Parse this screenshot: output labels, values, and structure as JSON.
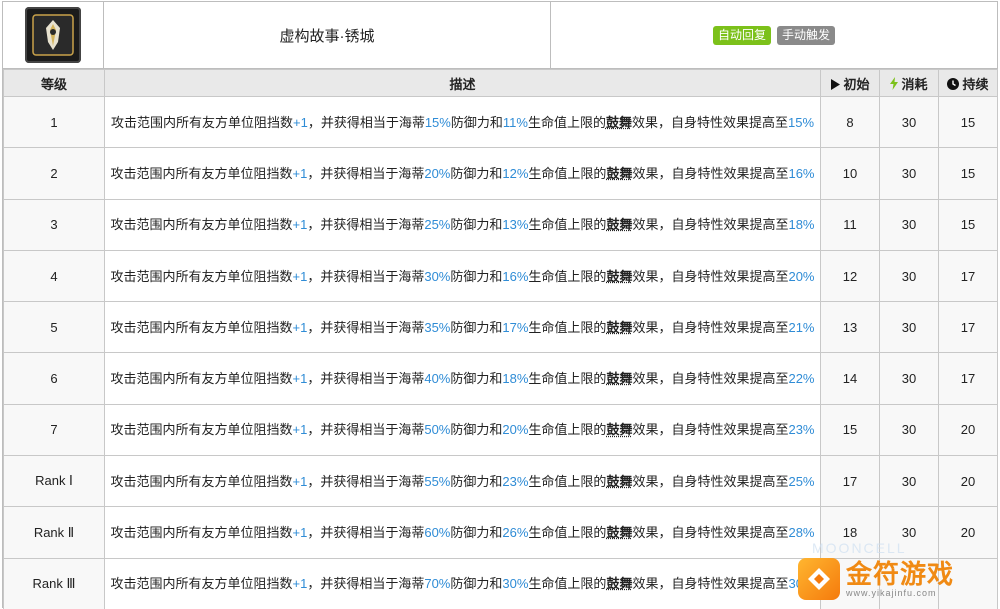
{
  "skill": {
    "name": "虚构故事·锈城",
    "tags": [
      "自动回复",
      "手动触发"
    ]
  },
  "table": {
    "headers": {
      "level": "等级",
      "desc": "描述",
      "init": "初始",
      "cost": "消耗",
      "duration": "持续"
    },
    "desc_text": {
      "a": "攻击范围内所有友方单位阻挡数",
      "plus": "+1",
      "b": "，并获得相当于海蒂",
      "c": "防御力和",
      "d": "生命值上限的",
      "e": "鼓舞",
      "f": "效果，自身特性效果提高至"
    },
    "rows": [
      {
        "level": "1",
        "def": "15%",
        "hp": "11%",
        "trait": "15%",
        "init": "8",
        "cost": "30",
        "duration": "15"
      },
      {
        "level": "2",
        "def": "20%",
        "hp": "12%",
        "trait": "16%",
        "init": "10",
        "cost": "30",
        "duration": "15"
      },
      {
        "level": "3",
        "def": "25%",
        "hp": "13%",
        "trait": "18%",
        "init": "11",
        "cost": "30",
        "duration": "15"
      },
      {
        "level": "4",
        "def": "30%",
        "hp": "16%",
        "trait": "20%",
        "init": "12",
        "cost": "30",
        "duration": "17"
      },
      {
        "level": "5",
        "def": "35%",
        "hp": "17%",
        "trait": "21%",
        "init": "13",
        "cost": "30",
        "duration": "17"
      },
      {
        "level": "6",
        "def": "40%",
        "hp": "18%",
        "trait": "22%",
        "init": "14",
        "cost": "30",
        "duration": "17"
      },
      {
        "level": "7",
        "def": "50%",
        "hp": "20%",
        "trait": "23%",
        "init": "15",
        "cost": "30",
        "duration": "20"
      },
      {
        "level": "Rank Ⅰ",
        "def": "55%",
        "hp": "23%",
        "trait": "25%",
        "init": "17",
        "cost": "30",
        "duration": "20"
      },
      {
        "level": "Rank Ⅱ",
        "def": "60%",
        "hp": "26%",
        "trait": "28%",
        "init": "18",
        "cost": "30",
        "duration": "20"
      },
      {
        "level": "Rank Ⅲ",
        "def": "70%",
        "hp": "30%",
        "trait": "30%",
        "init": "",
        "cost": "",
        "duration": ""
      }
    ]
  },
  "watermark": {
    "title": "金符游戏",
    "url": "www.yikajinfu.com",
    "bg_text": "MOONCELL"
  },
  "colors": {
    "accent_blue": "#2f8cd6",
    "tag_auto": "#7cc11a",
    "tag_manual": "#8a8a8a",
    "header_bg": "#e9e9e9"
  }
}
